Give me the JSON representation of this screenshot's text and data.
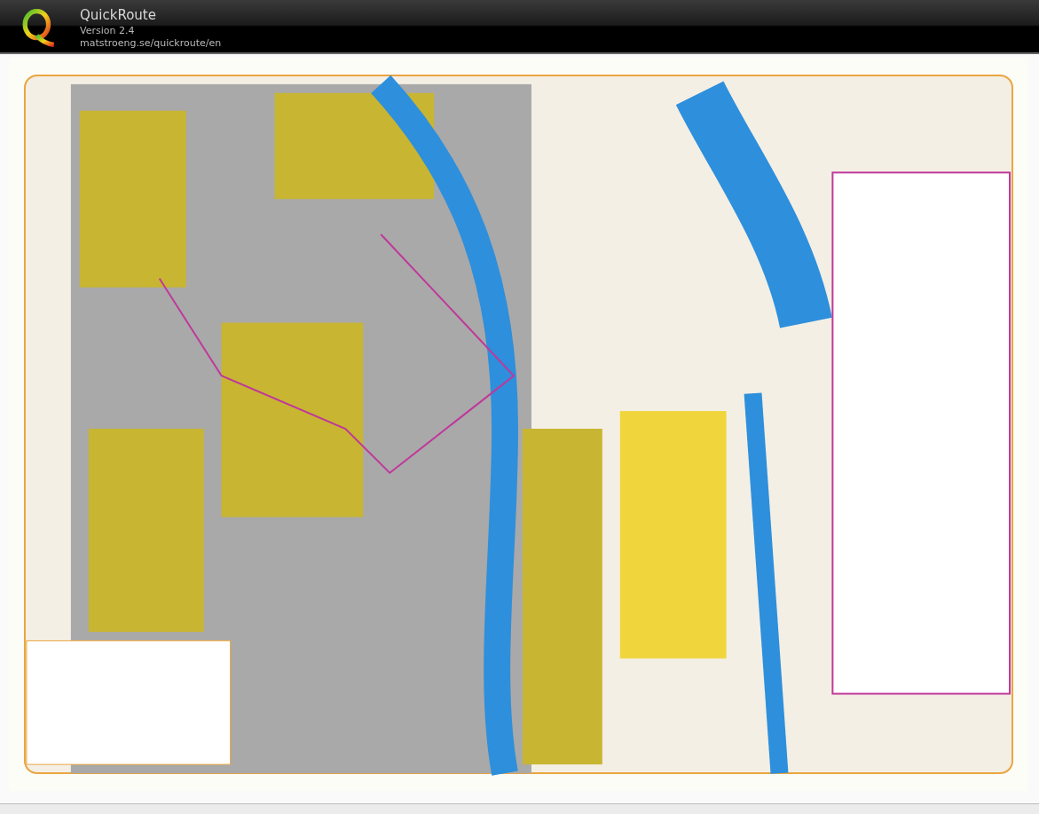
{
  "window": {
    "title": "QuickRoute",
    "version": "Version 2.4",
    "url": "matstroeng.se/quickroute/en"
  }
}
